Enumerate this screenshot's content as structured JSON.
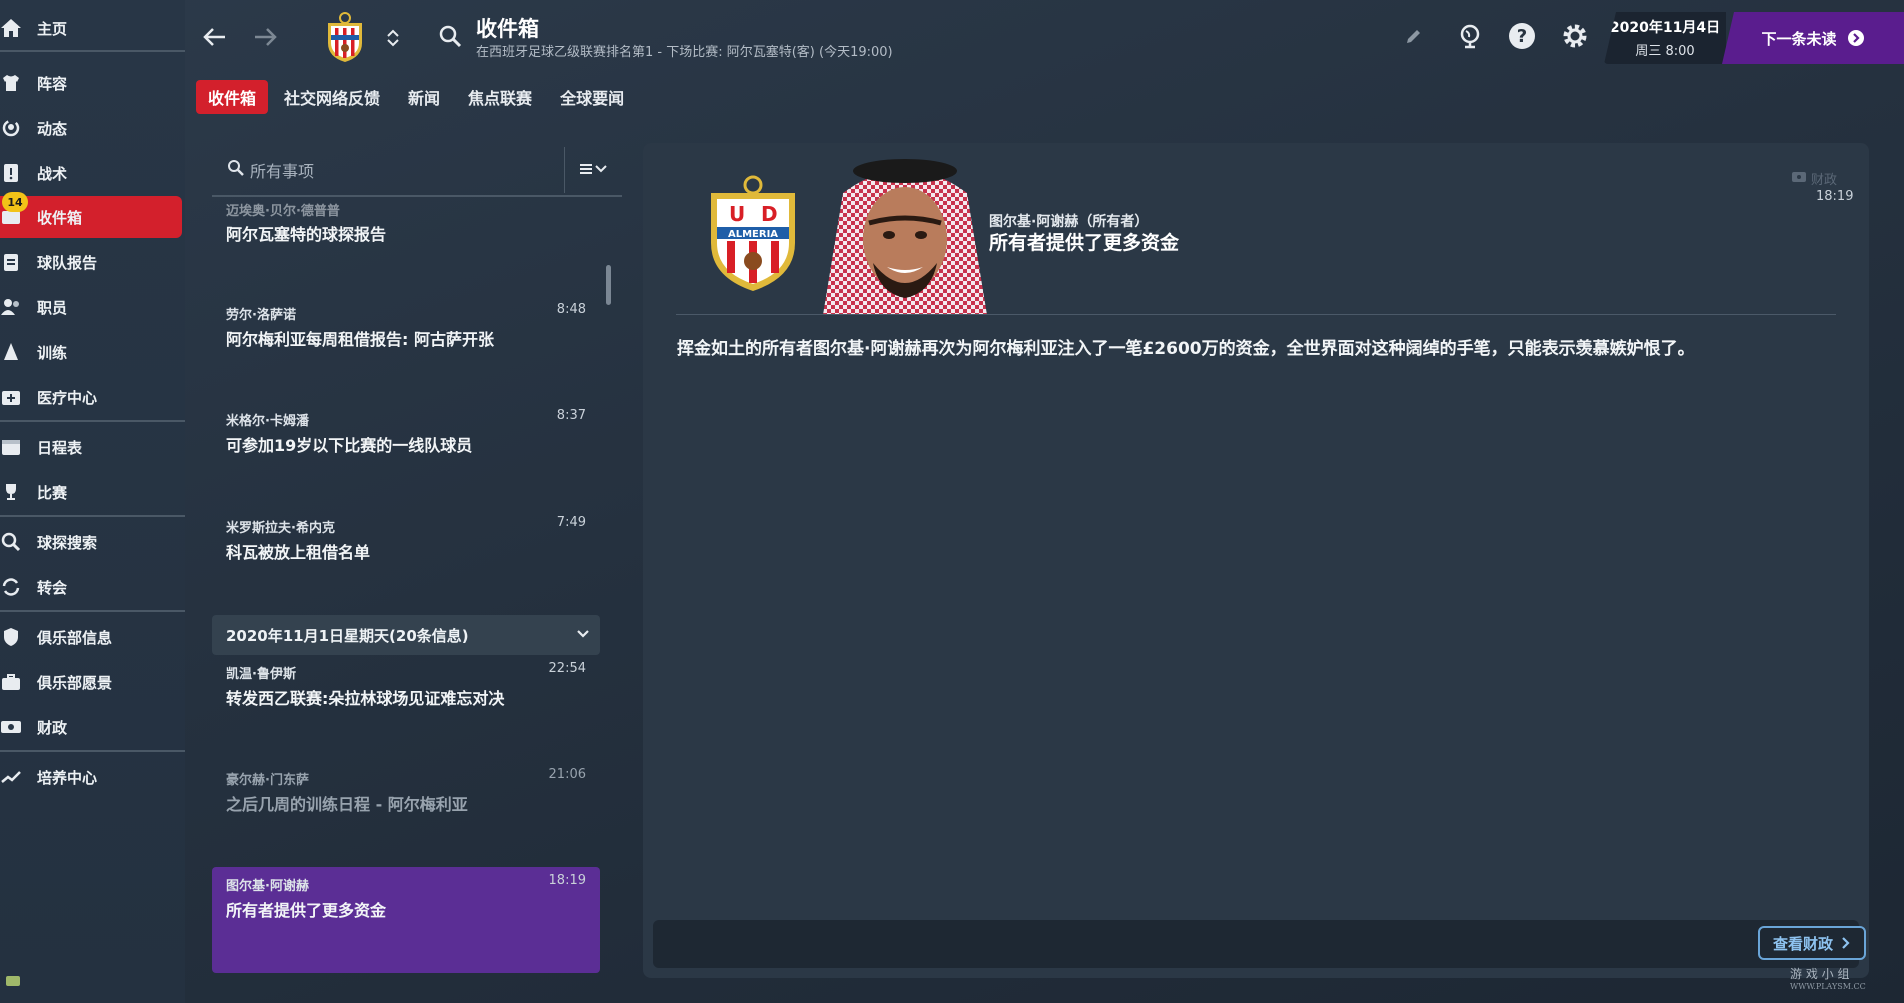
{
  "sidebar": {
    "items": [
      {
        "label": "主页",
        "icon": "home-icon"
      },
      {
        "label": "阵容",
        "icon": "shirt-icon"
      },
      {
        "label": "动态",
        "icon": "refresh-person-icon"
      },
      {
        "label": "战术",
        "icon": "tactics-board-icon"
      },
      {
        "label": "收件箱",
        "icon": "inbox-icon",
        "badge": "14",
        "active": true
      },
      {
        "label": "球队报告",
        "icon": "clipboard-icon"
      },
      {
        "label": "职员",
        "icon": "staff-icon"
      },
      {
        "label": "训练",
        "icon": "cone-icon"
      },
      {
        "label": "医疗中心",
        "icon": "medical-kit-icon"
      },
      {
        "label": "日程表",
        "icon": "calendar-icon"
      },
      {
        "label": "比赛",
        "icon": "trophy-icon"
      },
      {
        "label": "球探搜索",
        "icon": "magnifier-icon"
      },
      {
        "label": "转会",
        "icon": "transfer-icon"
      },
      {
        "label": "俱乐部信息",
        "icon": "shield-icon"
      },
      {
        "label": "俱乐部愿景",
        "icon": "briefcase-icon"
      },
      {
        "label": "财政",
        "icon": "money-icon"
      },
      {
        "label": "培养中心",
        "icon": "growth-chart-icon"
      }
    ]
  },
  "header": {
    "title": "收件箱",
    "subtitle": "在西班牙足球乙级联赛排名第1 - 下场比赛: 阿尔瓦塞特(客) (今天19:00)",
    "date": "2020年11月4日",
    "day_time": "周三 8:00",
    "next_button": "下一条未读"
  },
  "tabs": [
    "收件箱",
    "社交网络反馈",
    "新闻",
    "焦点联赛",
    "全球要闻"
  ],
  "search": {
    "placeholder": "所有事项"
  },
  "messages_top": [
    {
      "sender": "迈埃奥·贝尔·德普普",
      "subject": "阿尔瓦塞特的球探报告",
      "time": ""
    },
    {
      "sender": "劳尔·洛萨诺",
      "subject": "阿尔梅利亚每周租借报告: 阿古萨开张",
      "time": "8:48"
    },
    {
      "sender": "米格尔·卡姆潘",
      "subject": "可参加19岁以下比赛的一线队球员",
      "time": "8:37"
    },
    {
      "sender": "米罗斯拉夫·希内克",
      "subject": "科瓦被放上租借名单",
      "time": "7:49"
    }
  ],
  "date_group": "2020年11月1日星期天(20条信息)",
  "messages_bottom": [
    {
      "sender": "凯温·鲁伊斯",
      "subject": "转发西乙联赛:朵拉林球场见证难忘对决",
      "time": "22:54"
    },
    {
      "sender": "豪尔赫·门东萨",
      "subject": "之后几周的训练日程 - 阿尔梅利亚",
      "time": "21:06"
    },
    {
      "sender": "图尔基·阿谢赫",
      "subject": "所有者提供了更多资金",
      "time": "18:19"
    }
  ],
  "detail": {
    "sender_role": "图尔基·阿谢赫（所有者）",
    "subject": "所有者提供了更多资金",
    "tag": "财政",
    "time": "18:19",
    "body": "挥金如土的所有者图尔基·阿谢赫再次为阿尔梅利亚注入了一笔£2600万的资金，全世界面对这种阔绰的手笔，只能表示羡慕嫉妒恨了。",
    "view_button": "查看财政"
  },
  "club_crest": {
    "text": "UD ALMERIA",
    "colors": [
      "#d81f26",
      "#ffffff",
      "#f1c232"
    ]
  },
  "watermark": {
    "line1": "游 戏 小 组",
    "line2": "WWW.PLAYSM.CC"
  }
}
